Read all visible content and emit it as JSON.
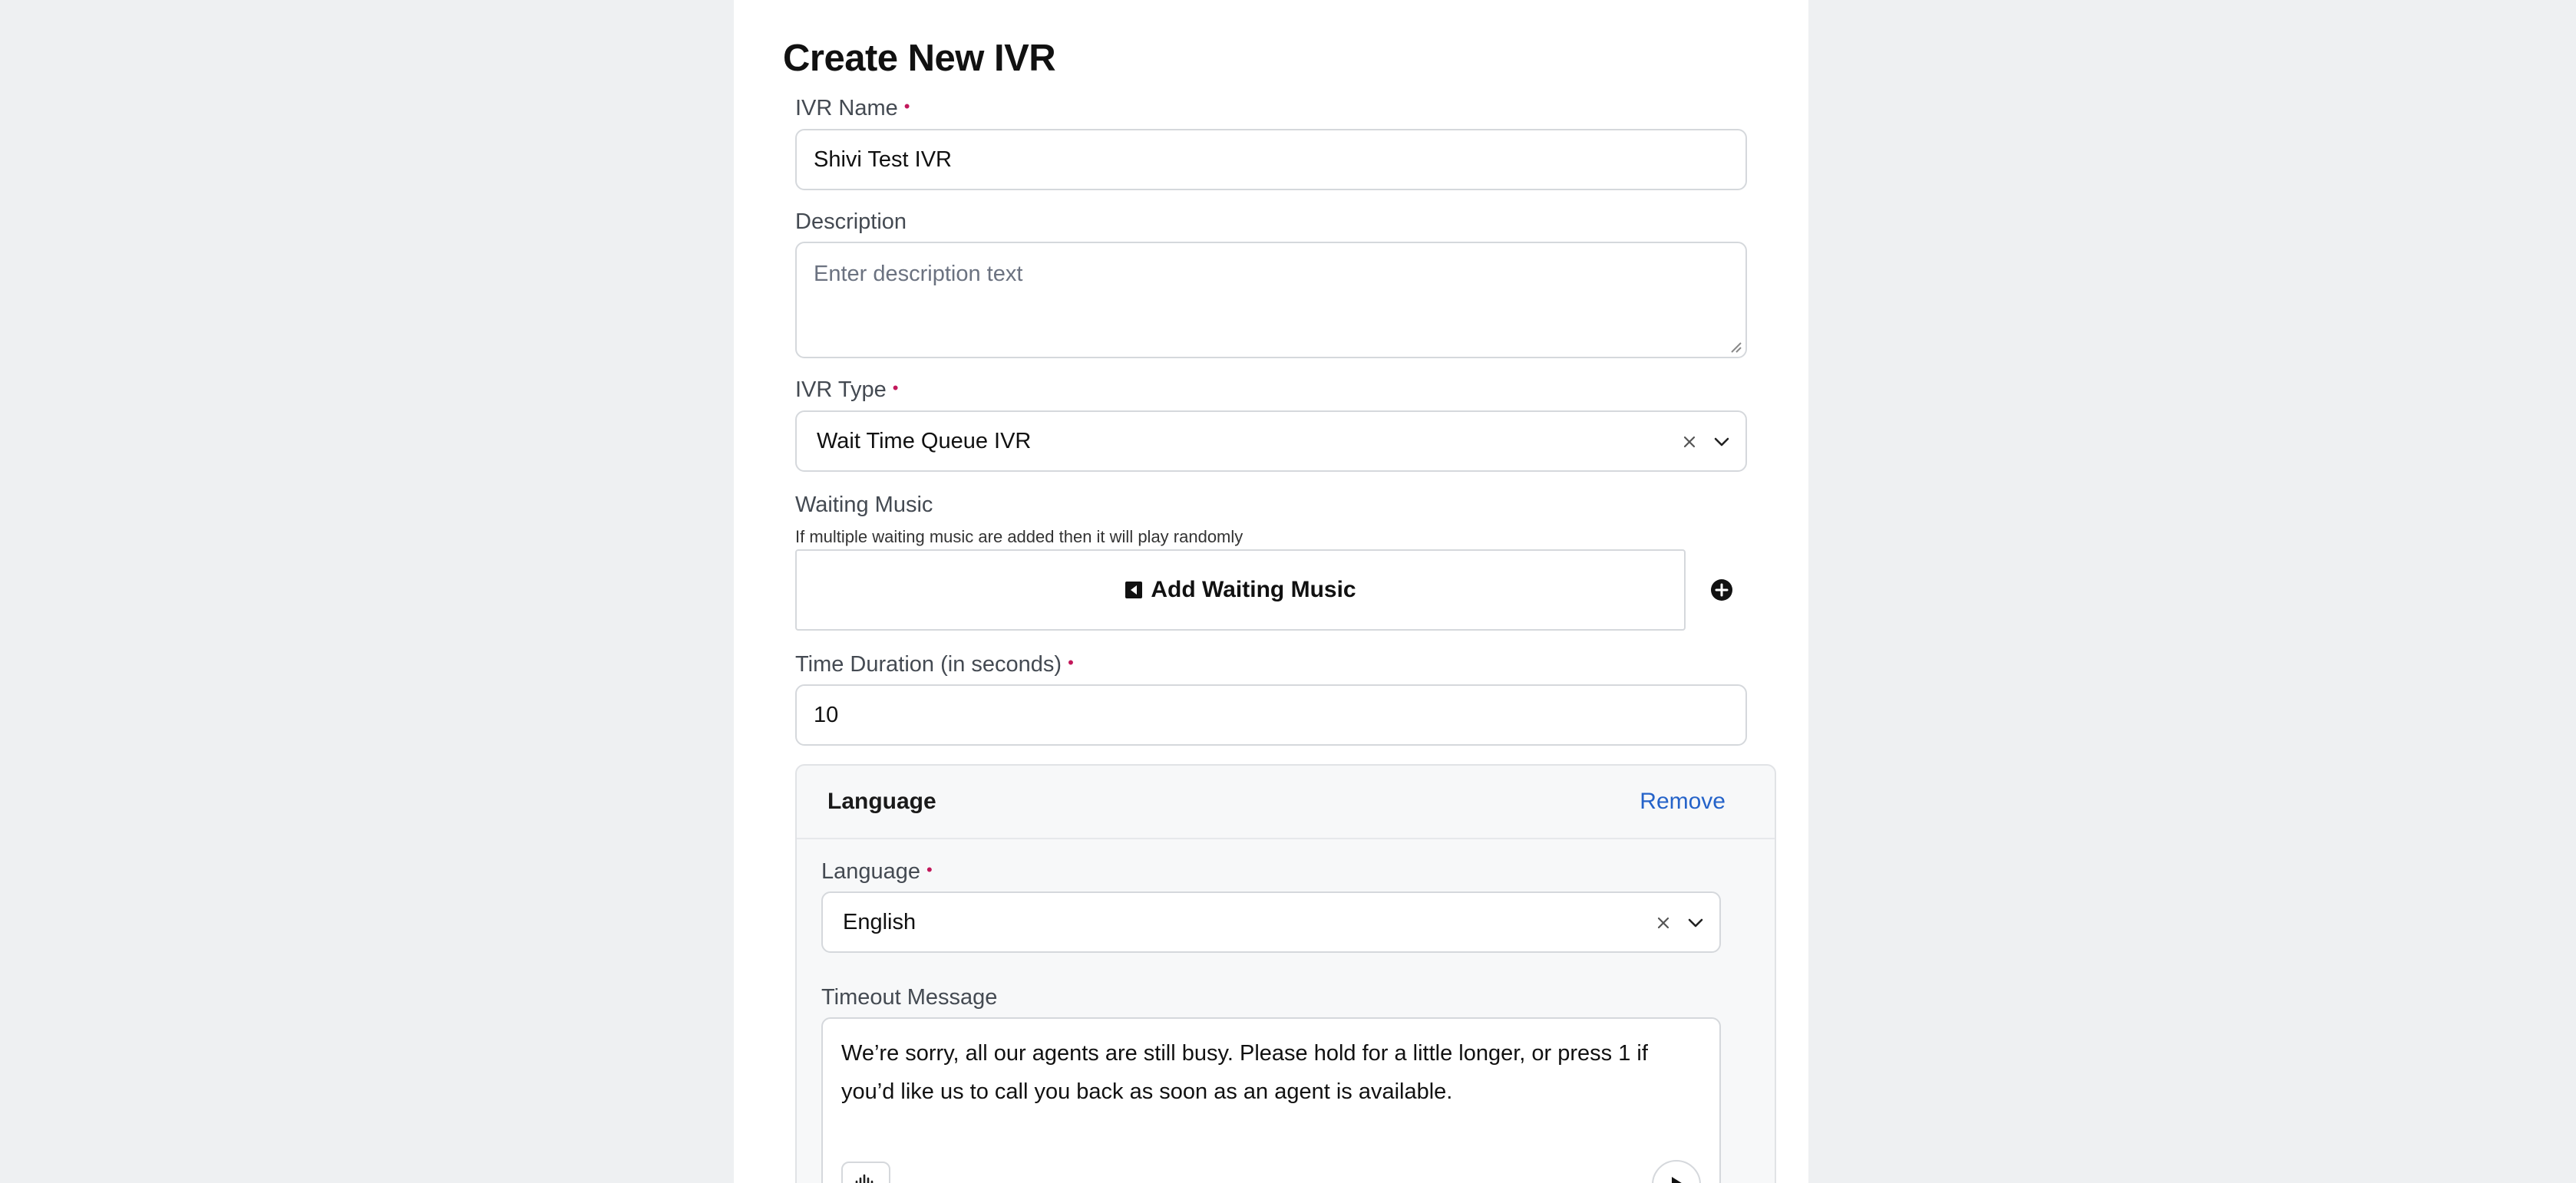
{
  "page": {
    "title": "Create New IVR"
  },
  "form": {
    "ivr_name": {
      "label": "IVR Name",
      "value": "Shivi Test IVR"
    },
    "description": {
      "label": "Description",
      "placeholder": "Enter description text"
    },
    "ivr_type": {
      "label": "IVR Type",
      "value": "Wait Time Queue IVR"
    },
    "waiting_music": {
      "label": "Waiting Music",
      "hint": "If multiple waiting music are added then it will play randomly",
      "add_label": "Add Waiting Music"
    },
    "time_duration": {
      "label": "Time Duration (in seconds)",
      "value": "10"
    },
    "language_card": {
      "title": "Language",
      "remove_label": "Remove",
      "language": {
        "label": "Language",
        "value": "English"
      },
      "timeout_message": {
        "label": "Timeout Message",
        "value": "We’re sorry, all our agents are still busy. Please hold for a little longer, or press 1 if you’d like us to call you back as soon as an agent is available."
      }
    }
  },
  "colors": {
    "required": "#c2185b",
    "link": "#2563c9",
    "background": "#eef0f2",
    "panel": "#ffffff"
  },
  "icons": [
    "clear-icon",
    "chevron-down-icon",
    "music-file-icon",
    "add-circle-icon",
    "waveform-icon",
    "play-icon"
  ]
}
